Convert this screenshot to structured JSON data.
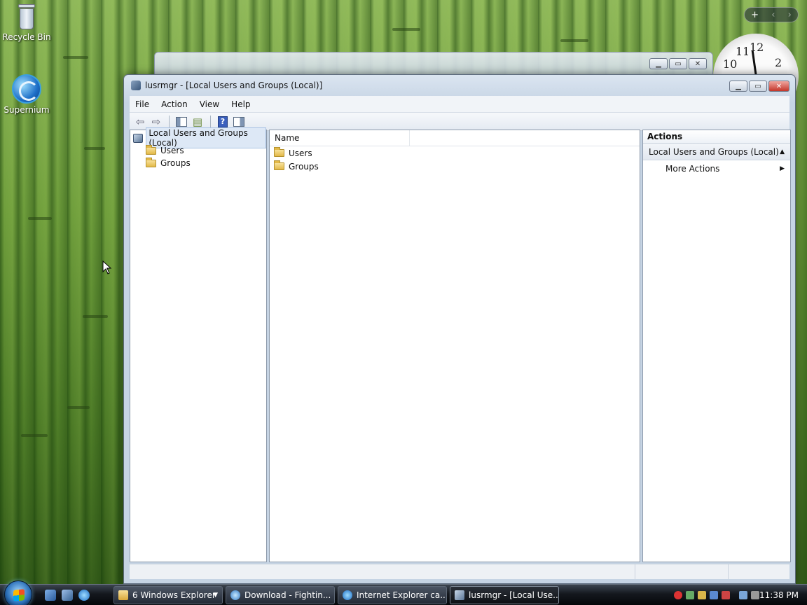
{
  "desktop": {
    "icons": [
      {
        "label": "Recycle Bin",
        "icon": "recycle-bin-icon"
      },
      {
        "label": "Supernium",
        "icon": "globe-icon"
      }
    ],
    "clock_numbers": [
      "11",
      "12",
      "10",
      "2"
    ]
  },
  "window": {
    "title": "lusrmgr - [Local Users and Groups (Local)]",
    "menu": [
      "File",
      "Action",
      "View",
      "Help"
    ],
    "toolbar": [
      "back-arrow-icon",
      "forward-arrow-icon",
      "show-hide-tree-icon",
      "export-list-icon",
      "help-icon",
      "show-hide-action-pane-icon"
    ],
    "tree": {
      "root": "Local Users and Groups (Local)",
      "children": [
        "Users",
        "Groups"
      ]
    },
    "list": {
      "column_name": "Name",
      "items": [
        "Users",
        "Groups"
      ]
    },
    "actions": {
      "header": "Actions",
      "section": "Local Users and Groups (Local)",
      "item": "More Actions"
    }
  },
  "taskbar": {
    "buttons": [
      {
        "label": "6 Windows Explorer",
        "icon": "folder-icon"
      },
      {
        "label": "Download - Fightin...",
        "icon": "browser-icon"
      },
      {
        "label": "Internet Explorer ca...",
        "icon": "ie-icon"
      },
      {
        "label": "lusrmgr - [Local Use...",
        "icon": "lusrmgr-icon",
        "active": true
      }
    ],
    "time": "11:38 PM"
  },
  "colors": {
    "selection": "#dde8f6",
    "taskbar": "#14181e",
    "window_frame": "#c6d4e4"
  }
}
